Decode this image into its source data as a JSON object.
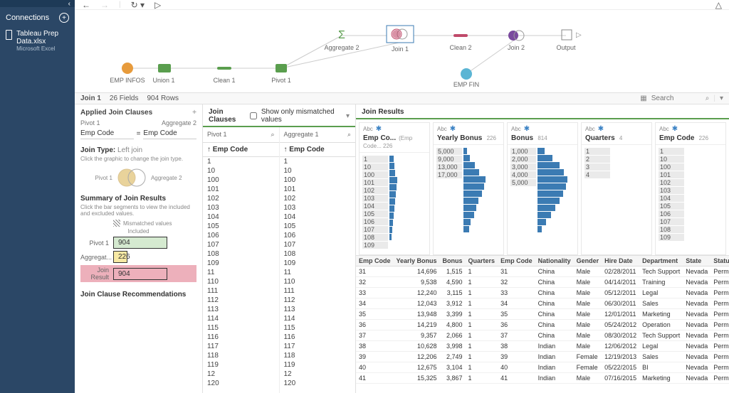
{
  "sidebar": {
    "title": "Connections",
    "conn": {
      "name": "Tableau Prep Data.xlsx",
      "sub": "Microsoft Excel"
    }
  },
  "flow": {
    "nodes": [
      "EMP INFOS",
      "Union 1",
      "Clean 1",
      "Pivot 1",
      "Aggregate 2",
      "Join 1",
      "Clean 2",
      "Join 2",
      "Output",
      "EMP FIN"
    ]
  },
  "status": {
    "step": "Join 1",
    "fields": "26 Fields",
    "rows": "904 Rows",
    "search_ph": "Search"
  },
  "panel1": {
    "applied": "Applied Join Clauses",
    "src1": "Pivot 1",
    "src2": "Aggregate 2",
    "fld1": "Emp Code",
    "fld2": "Emp Code",
    "jt_label": "Join Type:",
    "jt_value": "Left join",
    "jt_hint": "Click the graphic to change the join type.",
    "venn_l": "Pivot 1",
    "venn_r": "Aggregate 2",
    "summary": "Summary of Join Results",
    "s_hint": "Click the bar segments to view the included and excluded values.",
    "mism": "Mismatched values",
    "incl": "Included",
    "p1_l": "Pivot 1",
    "p1_v": "904",
    "p2_l": "Aggregat...",
    "p2_v": "226",
    "p3_l": "Join Result",
    "p3_v": "904",
    "recs": "Join Clause Recommendations"
  },
  "panel2": {
    "title": "Join Clauses",
    "chk": "Show only mismatched values",
    "c1": "Pivot 1",
    "c2": "Aggregate 1",
    "sub": "Emp Code",
    "vals1": [
      "1",
      "10",
      "100",
      "101",
      "102",
      "103",
      "104",
      "105",
      "106",
      "107",
      "108",
      "109",
      "11",
      "110",
      "111",
      "112",
      "113",
      "114",
      "115",
      "116",
      "117",
      "118",
      "119",
      "12",
      "120"
    ],
    "vals2": [
      "1",
      "10",
      "100",
      "101",
      "102",
      "103",
      "104",
      "105",
      "106",
      "107",
      "108",
      "109",
      "11",
      "110",
      "111",
      "112",
      "113",
      "114",
      "115",
      "116",
      "117",
      "118",
      "119",
      "12",
      "120"
    ]
  },
  "panel3": {
    "title": "Join Results",
    "cols": [
      {
        "name": "Emp Co...",
        "extra": "(Emp Code...",
        "cnt": "226",
        "vals": [
          "1",
          "10",
          "100",
          "101",
          "102",
          "103",
          "104",
          "105",
          "106",
          "107",
          "108",
          "109"
        ],
        "bars": [
          12,
          14,
          16,
          22,
          20,
          18,
          16,
          14,
          12,
          10,
          8,
          6
        ]
      },
      {
        "name": "Yearly Bonus",
        "cnt": "226",
        "vals": [
          "5,000",
          "9,000",
          "13,000",
          "17,000"
        ],
        "bars": [
          10,
          18,
          30,
          42,
          60,
          55,
          50,
          40,
          35,
          28,
          20,
          15
        ]
      },
      {
        "name": "Bonus",
        "cnt": "814",
        "vals": [
          "1,000",
          "2,000",
          "3,000",
          "4,000",
          "5,000"
        ],
        "bars": [
          20,
          40,
          60,
          72,
          80,
          76,
          70,
          60,
          48,
          36,
          24,
          12
        ]
      },
      {
        "name": "Quarters",
        "cnt": "4",
        "vals": [
          "1",
          "2",
          "3",
          "4"
        ],
        "bars": []
      },
      {
        "name": "Emp Code",
        "cnt": "226",
        "vals": [
          "1",
          "10",
          "100",
          "101",
          "102",
          "103",
          "104",
          "105",
          "106",
          "107",
          "108",
          "109"
        ],
        "bars": []
      }
    ],
    "th": [
      "Emp Code",
      "Yearly Bonus",
      "Bonus",
      "Quarters",
      "Emp Code",
      "Nationality",
      "Gender",
      "Hire Date",
      "Department",
      "State",
      "Status"
    ],
    "rows": [
      [
        "31",
        "14,696",
        "1,515",
        "1",
        "31",
        "China",
        "Male",
        "02/28/2011",
        "Tech Support",
        "Nevada",
        "Permanen"
      ],
      [
        "32",
        "9,538",
        "4,590",
        "1",
        "32",
        "China",
        "Male",
        "04/14/2011",
        "Training",
        "Nevada",
        "Permanen"
      ],
      [
        "33",
        "12,240",
        "3,115",
        "1",
        "33",
        "China",
        "Male",
        "05/12/2011",
        "Legal",
        "Nevada",
        "Permanen"
      ],
      [
        "34",
        "12,043",
        "3,912",
        "1",
        "34",
        "China",
        "Male",
        "06/30/2011",
        "Sales",
        "Nevada",
        "Permanen"
      ],
      [
        "35",
        "13,948",
        "3,399",
        "1",
        "35",
        "China",
        "Male",
        "12/01/2011",
        "Marketing",
        "Nevada",
        "Permanen"
      ],
      [
        "36",
        "14,219",
        "4,800",
        "1",
        "36",
        "China",
        "Male",
        "05/24/2012",
        "Operation",
        "Nevada",
        "Permanen"
      ],
      [
        "37",
        "9,357",
        "2,066",
        "1",
        "37",
        "China",
        "Male",
        "08/30/2012",
        "Tech Support",
        "Nevada",
        "Permanen"
      ],
      [
        "38",
        "10,628",
        "3,998",
        "1",
        "38",
        "Indian",
        "Male",
        "12/06/2012",
        "Legal",
        "Nevada",
        "Permanen"
      ],
      [
        "39",
        "12,206",
        "2,749",
        "1",
        "39",
        "Indian",
        "Female",
        "12/19/2013",
        "Sales",
        "Nevada",
        "Permanen"
      ],
      [
        "40",
        "12,675",
        "3,104",
        "1",
        "40",
        "Indian",
        "Female",
        "05/22/2015",
        "BI",
        "Nevada",
        "Permanen"
      ],
      [
        "41",
        "15,325",
        "3,867",
        "1",
        "41",
        "Indian",
        "Male",
        "07/16/2015",
        "Marketing",
        "Nevada",
        "Permanen"
      ]
    ]
  }
}
